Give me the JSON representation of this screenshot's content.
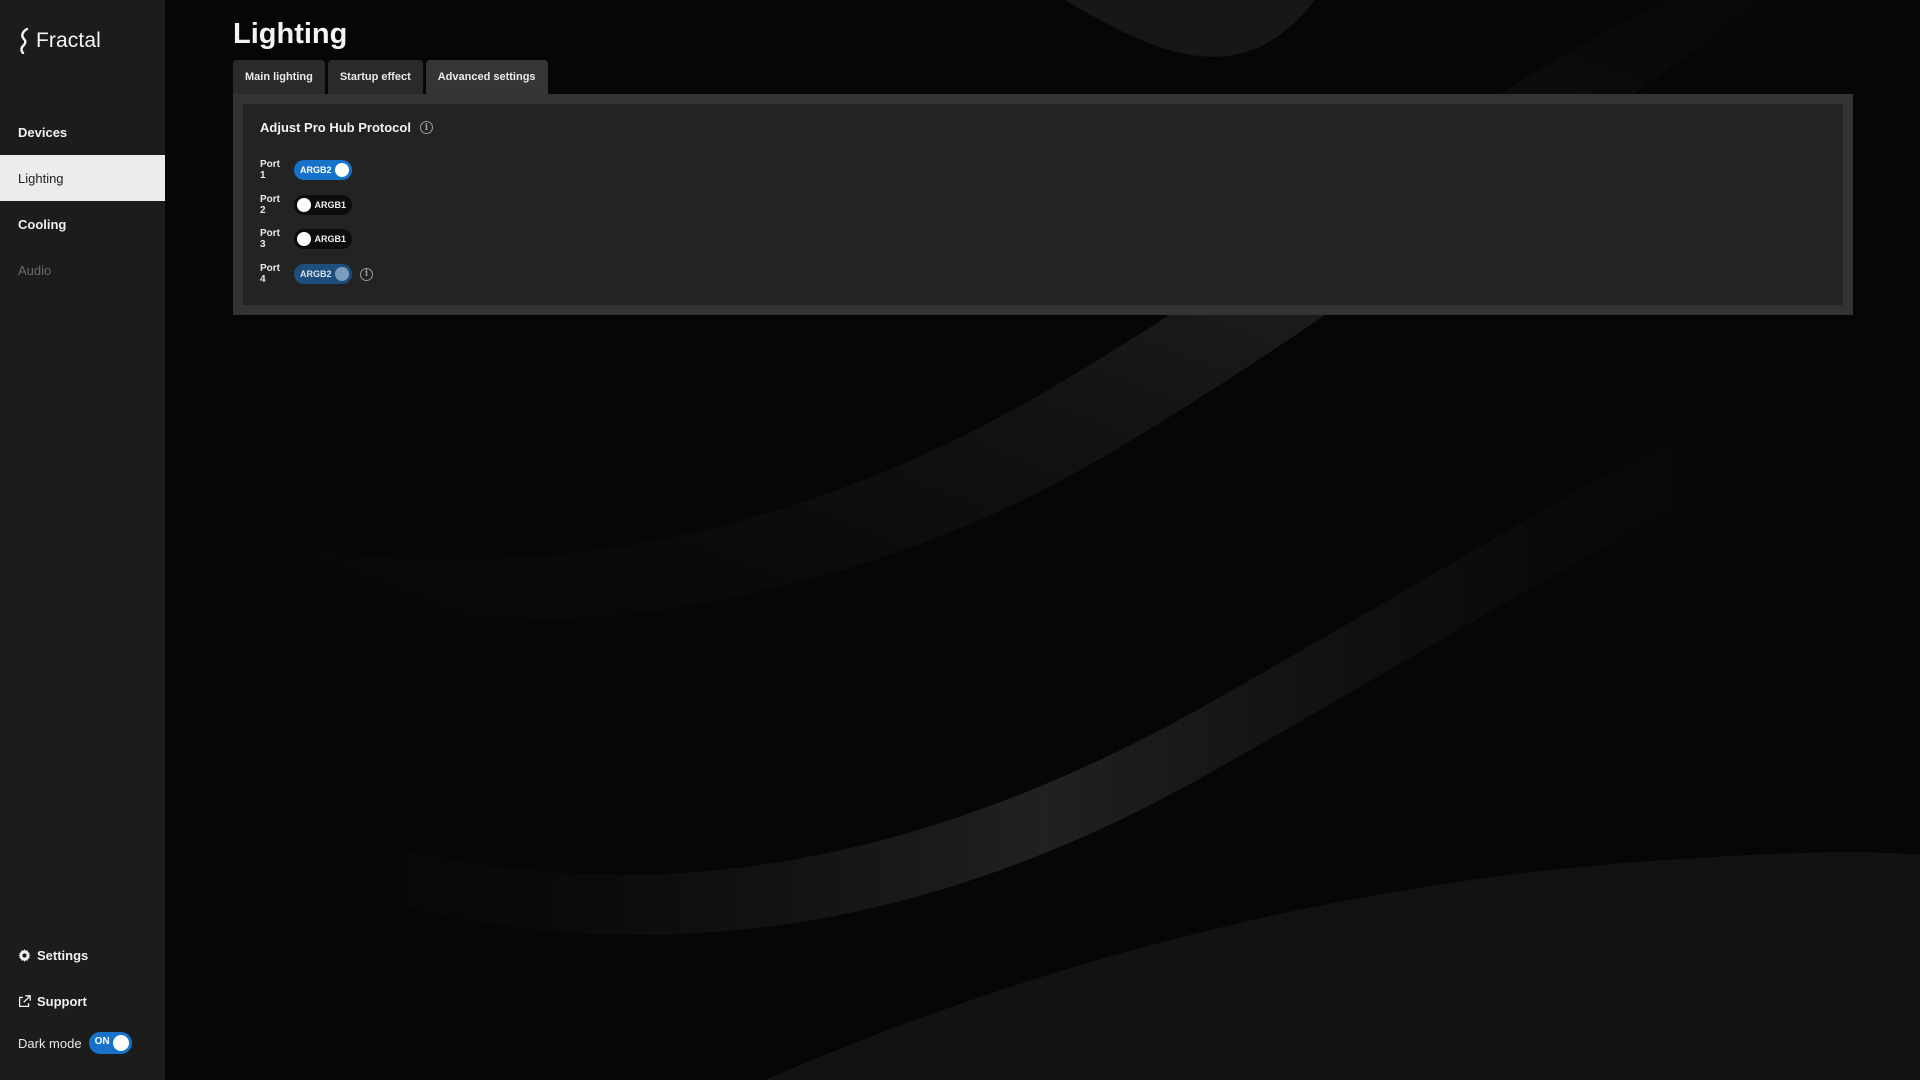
{
  "app": {
    "logo_text": "Fractal"
  },
  "sidebar": {
    "items": [
      {
        "label": "Devices",
        "state": "normal"
      },
      {
        "label": "Lighting",
        "state": "active"
      },
      {
        "label": "Cooling",
        "state": "normal"
      },
      {
        "label": "Audio",
        "state": "disabled"
      }
    ],
    "settings_label": "Settings",
    "support_label": "Support",
    "dark_mode_label": "Dark mode",
    "dark_mode_toggle": "ON"
  },
  "main": {
    "title": "Lighting",
    "tabs": [
      {
        "label": "Main lighting"
      },
      {
        "label": "Startup effect"
      },
      {
        "label": "Advanced settings",
        "active": true
      }
    ],
    "panel": {
      "title": "Adjust Pro Hub Protocol",
      "ports": [
        {
          "label": "Port 1",
          "value": "ARGB2",
          "state": "on"
        },
        {
          "label": "Port 2",
          "value": "ARGB1",
          "state": "off"
        },
        {
          "label": "Port 3",
          "value": "ARGB1",
          "state": "off"
        },
        {
          "label": "Port 4",
          "value": "ARGB2",
          "state": "on-disabled"
        }
      ]
    }
  },
  "colors": {
    "accent": "#1673c9",
    "sidebar_bg": "#1c1c1c",
    "panel_bg": "#232323",
    "panel_border": "#333333"
  }
}
